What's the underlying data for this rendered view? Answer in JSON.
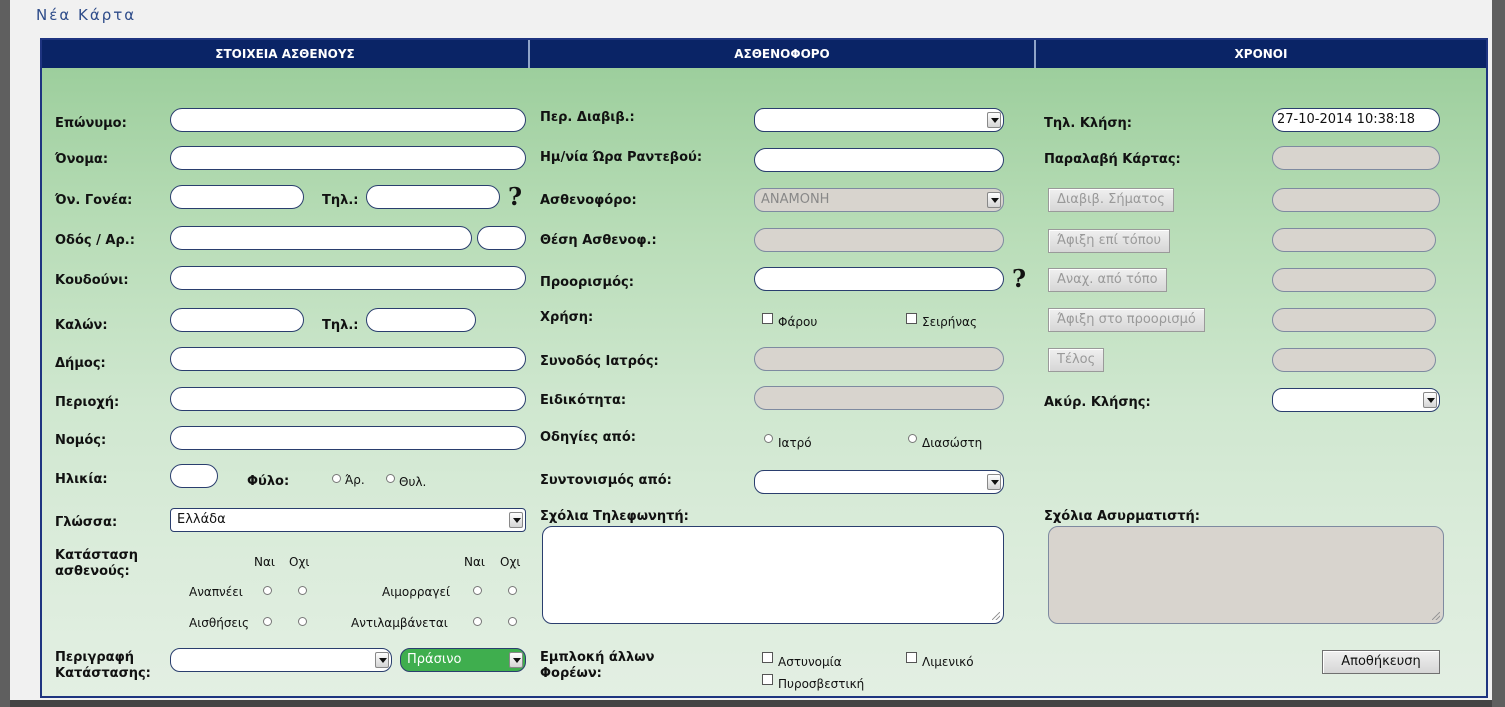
{
  "title": "Νέα Κάρτα",
  "headers": [
    "ΣΤΟΙΧΕΙΑ ΑΣΘΕΝΟΥΣ",
    "ΑΣΘΕΝΟΦΟΡΟ",
    "ΧΡΟΝΟΙ"
  ],
  "patient": {
    "surname": "Επώνυμο:",
    "name": "Όνομα:",
    "parent": "Όν. Γονέα:",
    "phone": "Τηλ.:",
    "street": "Οδός / Αρ.:",
    "doorbell": "Κουδούνι:",
    "caller": "Καλών:",
    "caller_phone": "Τηλ.:",
    "municipality": "Δήμος:",
    "area": "Περιοχή:",
    "prefecture": "Νομός:",
    "age": "Ηλικία:",
    "sex": "Φύλο:",
    "male": "Άρ.",
    "female": "Θυλ.",
    "language": "Γλώσσα:",
    "language_value": "Ελλάδα",
    "status_label_1": "Κατάσταση",
    "status_label_2": "ασθενούς:",
    "yes": "Ναι",
    "no": "Οχι",
    "breathes": "Αναπνέει",
    "bleeds": "Αιμορραγεί",
    "senses": "Αισθήσεις",
    "perceives": "Αντιλαμβάνεται",
    "desc_label_1": "Περιγραφή",
    "desc_label_2": "Κατάστασης:",
    "priority_value": "Πράσινο"
  },
  "ambulance": {
    "transport": "Περ. Διαβιβ.:",
    "appointment": "Ημ/νία Ώρα Ραντεβού:",
    "ambulance": "Ασθενοφόρο:",
    "ambulance_value": "ΑΝΑΜΟΝΗ",
    "position": "Θέση Ασθενοφ.:",
    "destination": "Προορισμός:",
    "use": "Χρήση:",
    "beacon": "Φάρου",
    "siren": "Σειρήνας",
    "doctor": "Συνοδός Ιατρός:",
    "specialty": "Ειδικότητα:",
    "instructions": "Οδηγίες από:",
    "by_doctor": "Ιατρό",
    "by_rescuer": "Διασώστη",
    "coordination": "Συντονισμός από:",
    "operator_notes": "Σχόλια Τηλεφωνητή:",
    "other_label_1": "Εμπλοκή άλλων",
    "other_label_2": "Φορέων:",
    "police": "Αστυνομία",
    "coast_guard": "Λιμενικό",
    "fire": "Πυροσβεστική"
  },
  "times": {
    "call": "Τηλ. Κλήση:",
    "call_value": "27-10-2014 10:38:18",
    "card_received": "Παραλαβή Κάρτας:",
    "btn_transmit": "Διαβιβ. Σήματος",
    "btn_arrival": "Άφιξη επί τόπου",
    "btn_departure": "Αναχ. από τόπο",
    "btn_dest": "Άφιξη στο προορισμό",
    "btn_end": "Τέλος",
    "cancel": "Ακύρ. Κλήσης:",
    "radio_notes": "Σχόλια Ασυρματιστή:",
    "save": "Αποθήκευση"
  }
}
